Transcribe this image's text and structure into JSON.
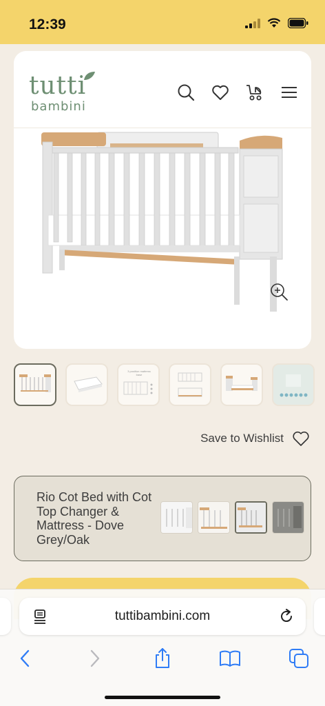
{
  "status_bar": {
    "time": "12:39"
  },
  "brand": {
    "logo_line1": "tutti",
    "logo_line2": "bambini",
    "brand_color": "#6e8f73"
  },
  "header": {
    "icons": [
      "search-icon",
      "heart-icon",
      "pram-cart-icon",
      "menu-icon"
    ]
  },
  "gallery": {
    "thumbnail_count": 6,
    "active_index": 0,
    "thumb3_text": "3 position mattress base"
  },
  "wishlist": {
    "label": "Save to Wishlist"
  },
  "variant": {
    "name": "Rio Cot Bed with Cot Top Changer & Mattress - Dove Grey/Oak",
    "swatch_count": 4,
    "selected_swatch": 2
  },
  "browser": {
    "url": "tuttibambini.com"
  },
  "colors": {
    "status_bar": "#f4d46b",
    "page_bg": "#f3ede4",
    "accent": "#f4d46b",
    "variant_bg": "#e5e0d5",
    "ios_blue": "#2f7cf6"
  }
}
